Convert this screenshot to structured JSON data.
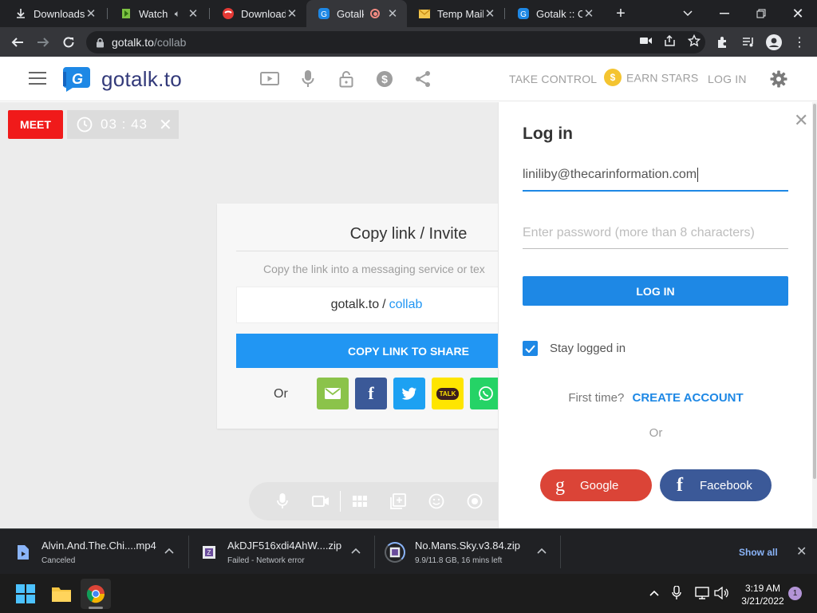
{
  "browser": {
    "tabs": [
      {
        "title": "Downloads"
      },
      {
        "title": "Watch"
      },
      {
        "title": "Download"
      },
      {
        "title": "Gotalk"
      },
      {
        "title": "Temp Mail"
      },
      {
        "title": "Gotalk :: Op"
      }
    ],
    "active_tab": 3,
    "url_host": "gotalk.to",
    "url_path": "/collab"
  },
  "site": {
    "brand": "gotalk.to",
    "nav": {
      "take_control": "TAKE CONTROL",
      "earn_stars": "EARN STARS",
      "log_in": "LOG IN"
    }
  },
  "meet": {
    "label": "MEET",
    "timer": "03 : 43"
  },
  "invite": {
    "title": "Copy link / Invite",
    "subtitle": "Copy the link into a messaging service or tex",
    "link_host": "gotalk.to",
    "link_sep": "/",
    "link_path": "collab",
    "copy_button": "COPY LINK TO SHARE",
    "or": "Or",
    "kakao": "TALK"
  },
  "login": {
    "title": "Log in",
    "email_value": "liniliby@thecarinformation.com",
    "password_placeholder": "Enter password (more than 8 characters)",
    "button": "LOG IN",
    "stay_logged_in": "Stay logged in",
    "stay_checked": true,
    "first_time": "First time?",
    "create_account": "CREATE ACCOUNT",
    "or": "Or",
    "google": "Google",
    "facebook": "Facebook"
  },
  "downloads": [
    {
      "name": "Alvin.And.The.Chi....mp4",
      "status": "Canceled"
    },
    {
      "name": "AkDJF516xdi4AhW....zip",
      "status": "Failed - Network error"
    },
    {
      "name": "No.Mans.Sky.v3.84.zip",
      "status": "9.9/11.8 GB, 16 mins left"
    }
  ],
  "downloads_show_all": "Show all",
  "taskbar": {
    "time": "3:19 AM",
    "date": "3/21/2022",
    "notifications": "1"
  },
  "colors": {
    "accent": "#2196f3",
    "meet_red": "#f01a1a",
    "google": "#db4437",
    "facebook": "#3b5998",
    "brand_navy": "#333a7a"
  }
}
